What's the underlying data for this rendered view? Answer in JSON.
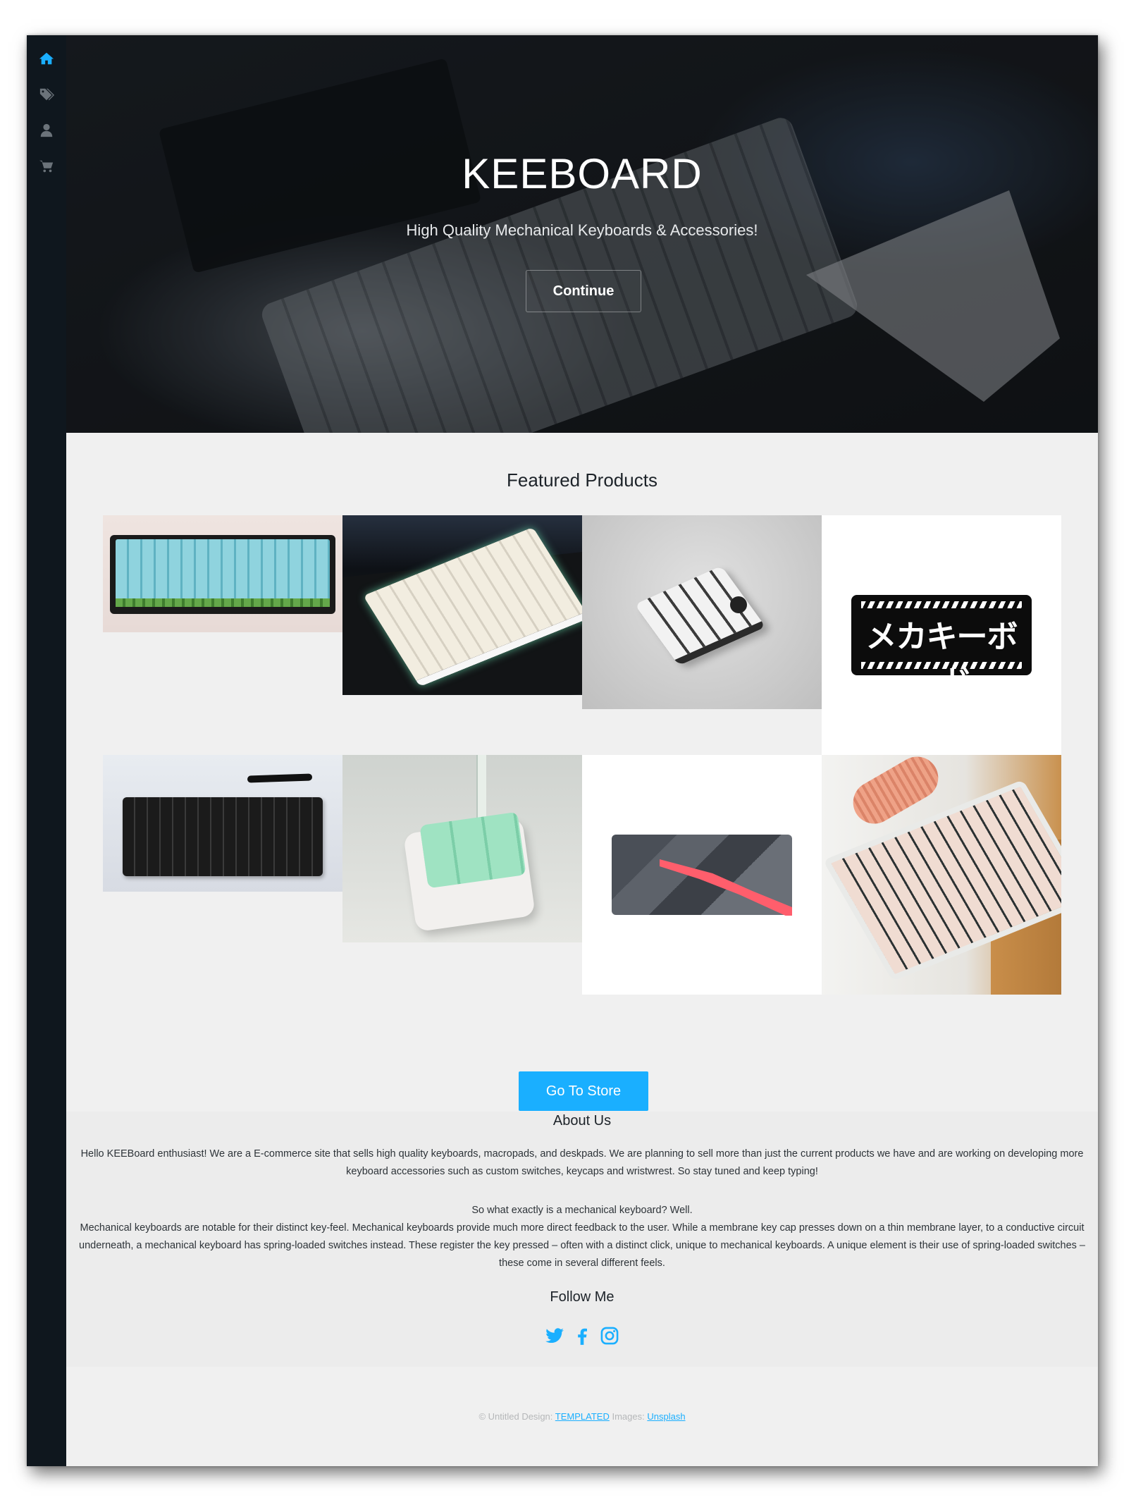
{
  "sidebar": {
    "items": [
      {
        "icon": "home-icon",
        "label": "Home",
        "color": "#1aafff"
      },
      {
        "icon": "tags-icon",
        "label": "Products",
        "color": "#6b737a"
      },
      {
        "icon": "user-icon",
        "label": "Account",
        "color": "#6b737a"
      },
      {
        "icon": "cart-icon",
        "label": "Cart",
        "color": "#6b737a"
      }
    ]
  },
  "hero": {
    "title": "KEEBOARD",
    "subtitle": "High Quality Mechanical Keyboards & Accessories!",
    "button_label": "Continue"
  },
  "featured": {
    "title": "Featured Products",
    "store_button_label": "Go To Store",
    "products_text": {
      "mousepad_3": "メカキーボード"
    }
  },
  "about": {
    "title": "About Us",
    "paragraph1": "Hello KEEBoard enthusiast! We are a E-commerce site that sells high quality keyboards, macropads, and deskpads. We are planning to sell more than just the current products we have and are working on developing more keyboard accessories such as custom switches, keycaps and wristwrest. So stay tuned and keep typing!",
    "question": "So what exactly is a mechanical keyboard? Well.",
    "paragraph2": "Mechanical keyboards are notable for their distinct key-feel. Mechanical keyboards provide much more direct feedback to the user. While a membrane key cap presses down on a thin membrane layer, to a conductive circuit underneath, a mechanical keyboard has spring-loaded switches instead. These register the key pressed – often with a distinct click, unique to mechanical keyboards. A unique element is their use of spring-loaded switches – these come in several different feels."
  },
  "follow": {
    "title": "Follow Me",
    "icons": [
      "twitter-icon",
      "facebook-icon",
      "instagram-icon"
    ],
    "color": "#1aafff"
  },
  "footer": {
    "prefix": "© Untitled Design:",
    "design_link": "TEMPLATED",
    "images_label": "Images:",
    "images_link": "Unsplash"
  },
  "colors": {
    "accent": "#1aafff",
    "sidebar": "#0f171e",
    "page_bg": "#f0f0f0"
  }
}
